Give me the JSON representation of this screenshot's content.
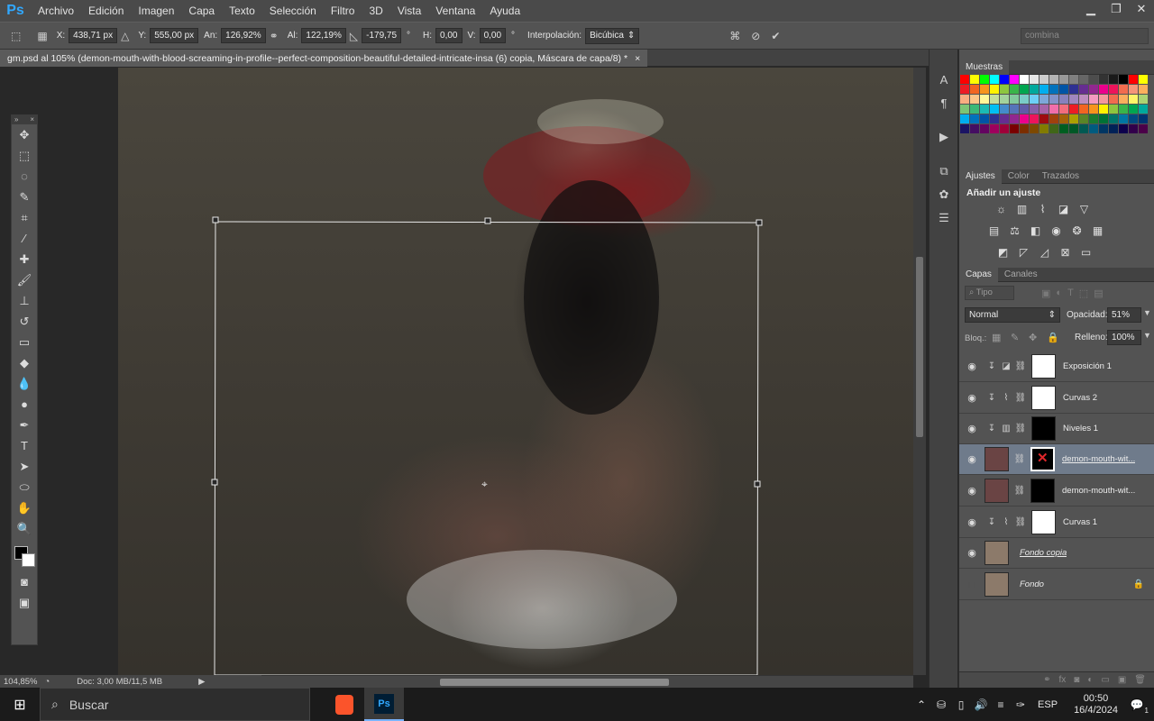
{
  "menu": {
    "logo": "Ps",
    "items": [
      "Archivo",
      "Edición",
      "Imagen",
      "Capa",
      "Texto",
      "Selección",
      "Filtro",
      "3D",
      "Vista",
      "Ventana",
      "Ayuda"
    ]
  },
  "options": {
    "x_label": "X:",
    "x_value": "438,71 px",
    "y_label": "Y:",
    "y_value": "555,00 px",
    "w_label": "An:",
    "w_value": "126,92%",
    "h_label": "Al:",
    "h_value": "122,19%",
    "angle_value": "-179,75",
    "angle_unit": "°",
    "hskew_label": "H:",
    "hskew_value": "0,00",
    "vskew_label": "V:",
    "vskew_value": "0,00",
    "interp_label": "Interpolación:",
    "interp_value": "Bicúbica",
    "workspace_value": "combina"
  },
  "document": {
    "tab_title": "gm.psd al 105% (demon-mouth-with-blood-screaming-in-profile--perfect-composition-beautiful-detailed-intricate-insa (6) copia, Máscara de capa/8) *",
    "close": "×"
  },
  "status": {
    "zoom": "104,85%",
    "doc_info": "Doc: 3,00 MB/11,5 MB"
  },
  "panels": {
    "swatches_tab": "Muestras",
    "adjust_tabs": [
      "Ajustes",
      "Color",
      "Trazados"
    ],
    "adjust_title": "Añadir un ajuste",
    "layers_tabs": [
      "Capas",
      "Canales"
    ],
    "filter_label": "Tipo",
    "blend_mode": "Normal",
    "opacity_label": "Opacidad:",
    "opacity_value": "51%",
    "lock_label": "Bloq.:",
    "fill_label": "Relleno:",
    "fill_value": "100%"
  },
  "layers": [
    {
      "name": "Exposición 1"
    },
    {
      "name": "Curvas 2"
    },
    {
      "name": "Niveles 1"
    },
    {
      "name": "demon-mouth-wit..."
    },
    {
      "name": "demon-mouth-wit..."
    },
    {
      "name": "Curvas 1"
    },
    {
      "name": "Fondo copia"
    },
    {
      "name": "Fondo"
    }
  ],
  "taskbar": {
    "search_placeholder": "Buscar",
    "lang": "ESP",
    "time": "00:50",
    "date": "16/4/2024",
    "notif_count": "1"
  },
  "colors": {
    "accent": "#31a8ff",
    "selected_layer": "#6f7b8b"
  }
}
